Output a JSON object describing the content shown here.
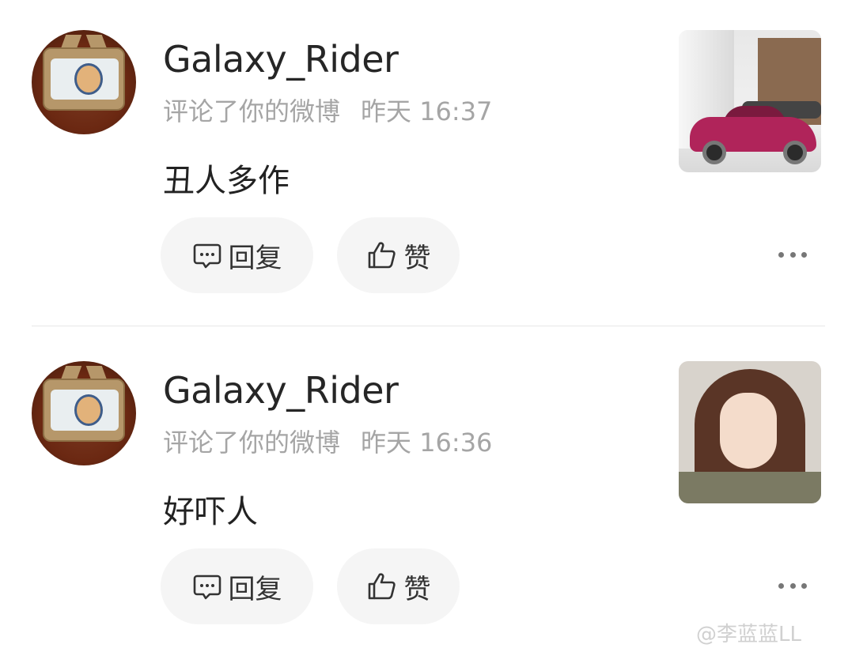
{
  "notifications": [
    {
      "username": "Galaxy_Rider",
      "action": "评论了你的微博",
      "time": "昨天 16:37",
      "comment": "丑人多作",
      "reply_label": "回复",
      "like_label": "赞",
      "thumb": "car-photo"
    },
    {
      "username": "Galaxy_Rider",
      "action": "评论了你的微博",
      "time": "昨天 16:36",
      "comment": "好吓人",
      "reply_label": "回复",
      "like_label": "赞",
      "thumb": "person-photo"
    }
  ],
  "watermark": "@李蓝蓝LL",
  "colors": {
    "pill_bg": "#f5f5f5",
    "meta_text": "#a5a5a5",
    "divider": "#e8e8e8"
  }
}
